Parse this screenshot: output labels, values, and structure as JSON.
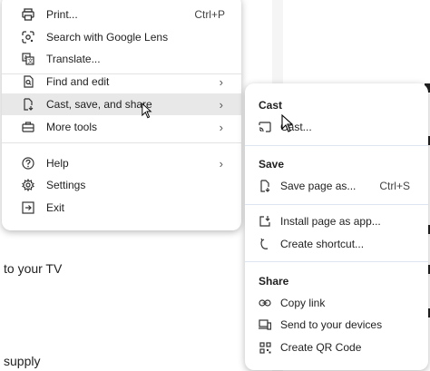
{
  "background": {
    "text_line_1": "to your TV",
    "text_line_2": "supply"
  },
  "main_menu": {
    "items": [
      {
        "label": "Print...",
        "shortcut": "Ctrl+P",
        "icon": "printer-icon"
      },
      {
        "label": "Search with Google Lens",
        "icon": "lens-icon"
      },
      {
        "label": "Translate...",
        "icon": "translate-icon"
      },
      {
        "label": "Find and edit",
        "icon": "find-icon",
        "has_submenu": true
      },
      {
        "label": "Cast, save, and share",
        "icon": "cast-save-share-icon",
        "has_submenu": true,
        "highlighted": true
      },
      {
        "label": "More tools",
        "icon": "toolbox-icon",
        "has_submenu": true
      },
      {
        "label": "Help",
        "icon": "help-icon",
        "has_submenu": true
      },
      {
        "label": "Settings",
        "icon": "gear-icon"
      },
      {
        "label": "Exit",
        "icon": "exit-icon"
      }
    ],
    "arrow": "›"
  },
  "submenu": {
    "sections": [
      {
        "header": "Cast",
        "items": [
          {
            "label": "Cast...",
            "icon": "cast-icon"
          }
        ]
      },
      {
        "header": "Save",
        "items": [
          {
            "label": "Save page as...",
            "shortcut": "Ctrl+S",
            "icon": "save-page-icon"
          },
          {
            "label": "Install page as app...",
            "icon": "install-app-icon"
          },
          {
            "label": "Create shortcut...",
            "icon": "shortcut-icon"
          }
        ]
      },
      {
        "header": "Share",
        "items": [
          {
            "label": "Copy link",
            "icon": "link-icon"
          },
          {
            "label": "Send to your devices",
            "icon": "devices-icon"
          },
          {
            "label": "Create QR Code",
            "icon": "qr-code-icon"
          }
        ]
      }
    ]
  },
  "colors": {
    "highlight": "#e8e8e8",
    "separator": "#e3e3e3",
    "text": "#1f1f1f"
  }
}
